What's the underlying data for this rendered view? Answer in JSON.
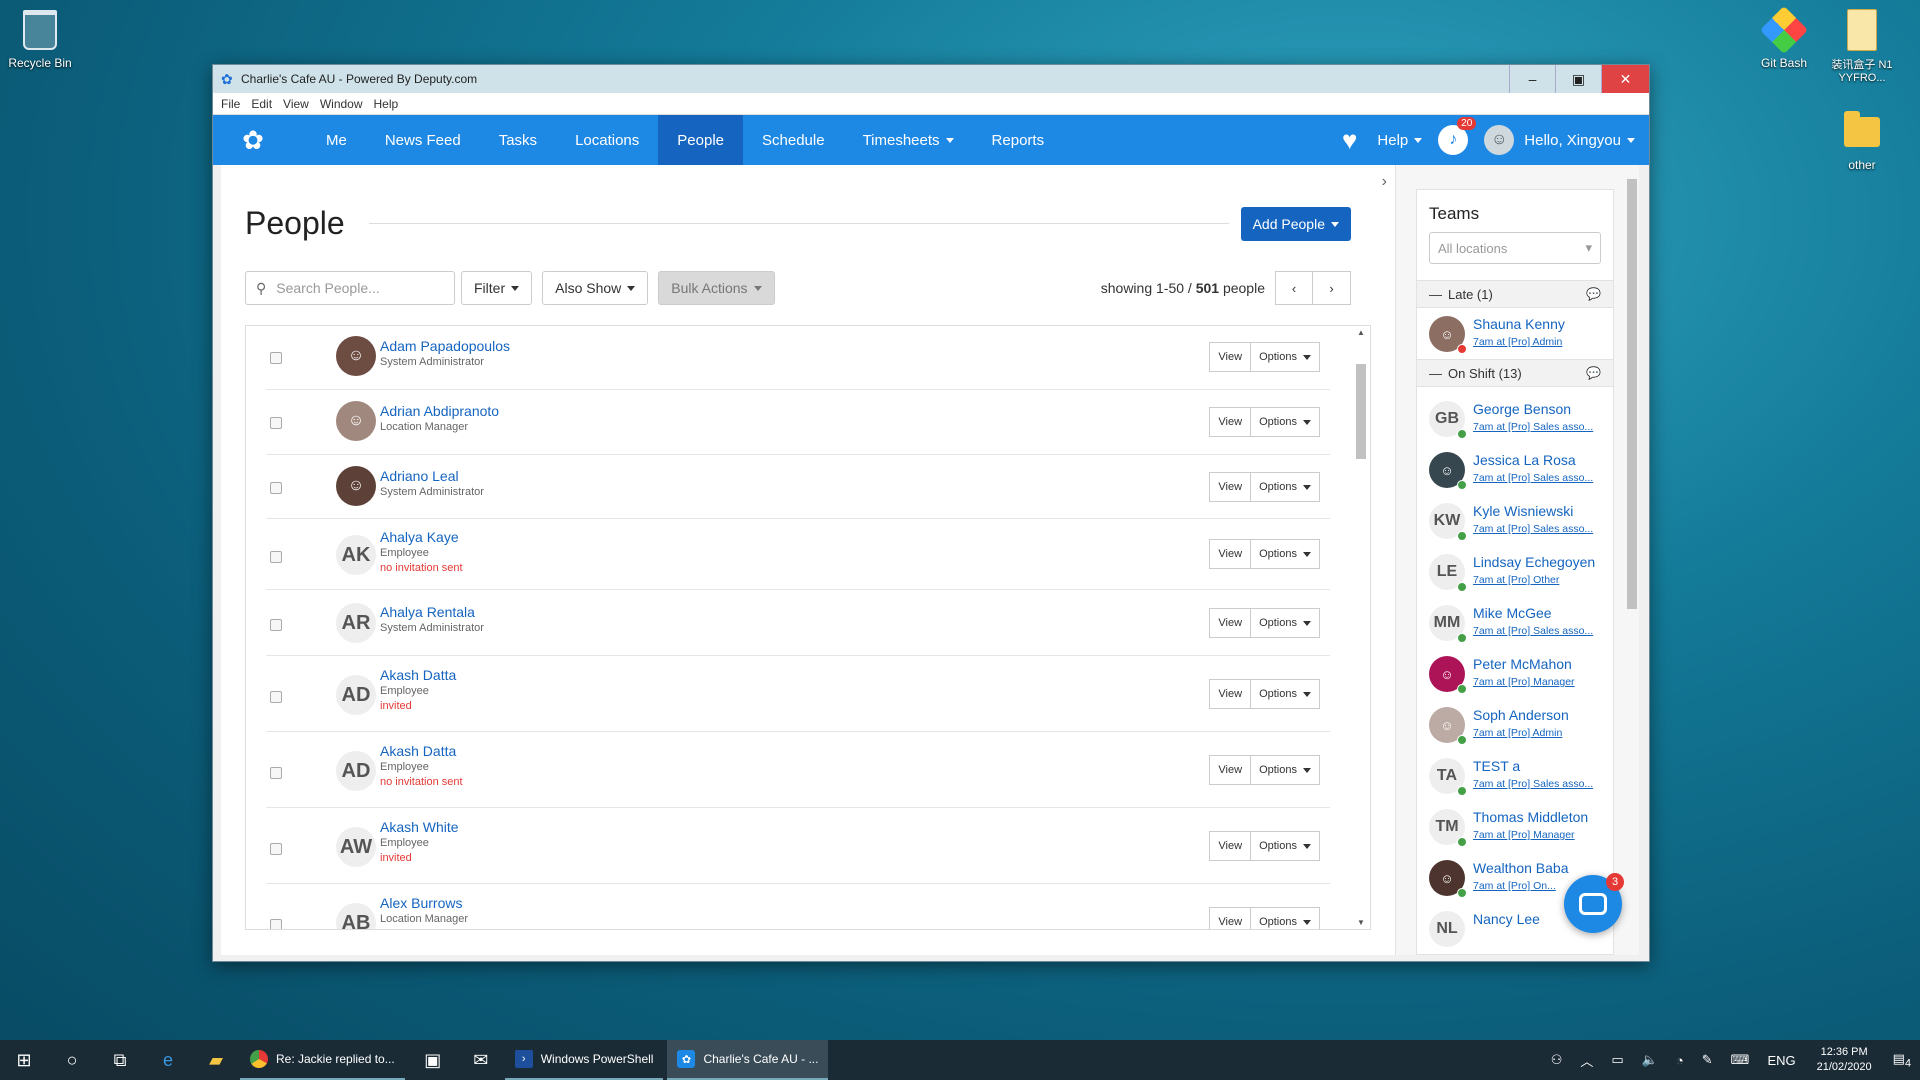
{
  "desktop": {
    "icons": [
      {
        "label": "Recycle Bin"
      },
      {
        "label": "Git Bash"
      },
      {
        "label": "装讯盒子 N1 YYFRO..."
      },
      {
        "label": "other"
      }
    ]
  },
  "window": {
    "title": "Charlie's Cafe AU - Powered By Deputy.com",
    "menu": [
      "File",
      "Edit",
      "View",
      "Window",
      "Help"
    ]
  },
  "nav": {
    "items": [
      "Me",
      "News Feed",
      "Tasks",
      "Locations",
      "People",
      "Schedule",
      "Timesheets",
      "Reports"
    ],
    "active": "People",
    "help": "Help",
    "notif_count": "20",
    "greeting": "Hello, Xingyou"
  },
  "page": {
    "title": "People",
    "add_button": "Add People",
    "search_placeholder": "Search People...",
    "filter": "Filter",
    "also_show": "Also Show",
    "bulk_actions": "Bulk Actions",
    "showing_prefix": "showing 1-50 / ",
    "total": "501",
    "showing_suffix": " people"
  },
  "people": [
    {
      "name": "Adam Papadopoulos",
      "role": "System Administrator",
      "initials": "",
      "status": "",
      "photo": true
    },
    {
      "name": "Adrian Abdipranoto",
      "role": "Location Manager",
      "initials": "",
      "status": "",
      "photo": true
    },
    {
      "name": "Adriano Leal",
      "role": "System Administrator",
      "initials": "",
      "status": "",
      "photo": true
    },
    {
      "name": "Ahalya Kaye",
      "role": "Employee",
      "initials": "AK",
      "status": "no invitation sent"
    },
    {
      "name": "Ahalya Rentala",
      "role": "System Administrator",
      "initials": "AR",
      "status": ""
    },
    {
      "name": "Akash Datta",
      "role": "Employee",
      "initials": "AD",
      "status": "invited"
    },
    {
      "name": "Akash Datta",
      "role": "Employee",
      "initials": "AD",
      "status": "no invitation sent"
    },
    {
      "name": "Akash White",
      "role": "Employee",
      "initials": "AW",
      "status": "invited"
    },
    {
      "name": "Alex Burrows",
      "role": "Location Manager",
      "initials": "AB",
      "status": ""
    }
  ],
  "row_actions": {
    "view": "View",
    "options": "Options"
  },
  "teams": {
    "title": "Teams",
    "location_select": "All locations",
    "groups": [
      {
        "label": "Late (1)",
        "members": [
          {
            "name": "Shauna Kenny",
            "shift": "7am at [Pro] Admin",
            "initials": "",
            "photo": true,
            "late": true
          }
        ]
      },
      {
        "label": "On Shift (13)",
        "members": [
          {
            "name": "George Benson",
            "shift": "7am at [Pro] Sales asso...",
            "initials": "GB"
          },
          {
            "name": "Jessica La Rosa",
            "shift": "7am at [Pro] Sales asso...",
            "initials": "",
            "photo": true
          },
          {
            "name": "Kyle Wisniewski",
            "shift": "7am at [Pro] Sales asso...",
            "initials": "KW"
          },
          {
            "name": "Lindsay Echegoyen",
            "shift": "7am at [Pro] Other",
            "initials": "LE"
          },
          {
            "name": "Mike McGee",
            "shift": "7am at [Pro] Sales asso...",
            "initials": "MM"
          },
          {
            "name": "Peter McMahon",
            "shift": "7am at [Pro] Manager",
            "initials": "",
            "photo": true
          },
          {
            "name": "Soph Anderson",
            "shift": "7am at [Pro] Admin",
            "initials": "",
            "photo": true
          },
          {
            "name": "TEST a",
            "shift": "7am at [Pro] Sales asso...",
            "initials": "TA"
          },
          {
            "name": "Thomas Middleton",
            "shift": "7am at [Pro] Manager",
            "initials": "TM"
          },
          {
            "name": "Wealthon Baba",
            "shift": "7am at [Pro] On...",
            "initials": "",
            "photo": true
          },
          {
            "name": "Nancy Lee",
            "shift": "",
            "initials": "NL"
          }
        ]
      }
    ]
  },
  "chat": {
    "badge": "3"
  },
  "taskbar": {
    "apps": [
      "Re: Jackie replied to...",
      "Windows PowerShell",
      "Charlie's Cafe AU - ..."
    ],
    "lang": "ENG",
    "time": "12:36 PM",
    "date": "21/02/2020",
    "notif": "4"
  },
  "colors": {
    "brand": "#1e88e5",
    "nav_active": "#1565c0",
    "link": "#1565c0",
    "warn": "#e53935"
  }
}
